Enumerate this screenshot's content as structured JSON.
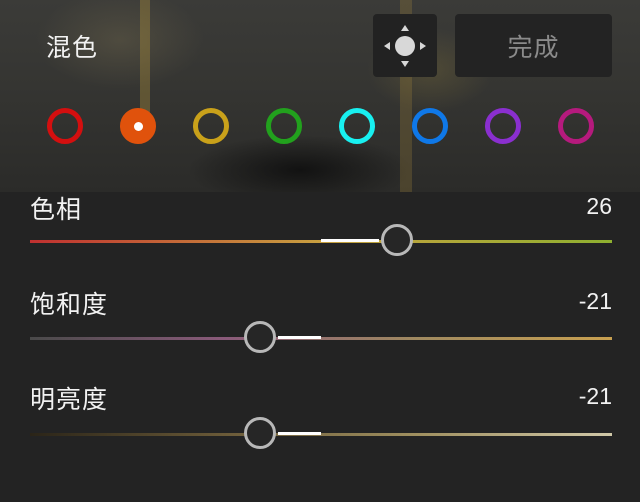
{
  "header": {
    "title": "混色",
    "target_icon": "target-adjust-icon",
    "done_label": "完成"
  },
  "swatches": [
    {
      "name": "red",
      "color": "#d40f0f",
      "selected": false
    },
    {
      "name": "orange",
      "color": "#e0520c",
      "selected": true
    },
    {
      "name": "yellow",
      "color": "#c9a11a",
      "selected": false
    },
    {
      "name": "green",
      "color": "#22a11d",
      "selected": false
    },
    {
      "name": "aqua",
      "color": "#18f0f0",
      "selected": false
    },
    {
      "name": "blue",
      "color": "#0f78e8",
      "selected": false
    },
    {
      "name": "purple",
      "color": "#8a2fcf",
      "selected": false
    },
    {
      "name": "magenta",
      "color": "#b51a7d",
      "selected": false
    }
  ],
  "sliders": [
    {
      "label": "色相",
      "value": "26",
      "numeric": 26,
      "min": -100,
      "max": 100,
      "track_gradient": [
        "#c03030",
        "#c8a040",
        "#8fb030"
      ]
    },
    {
      "label": "饱和度",
      "value": "-21",
      "numeric": -21,
      "min": -100,
      "max": 100,
      "track_gradient": [
        "#4a4a4a",
        "#8a5a7a",
        "#a08a60",
        "#c8a050"
      ]
    },
    {
      "label": "明亮度",
      "value": "-21",
      "numeric": -21,
      "min": -100,
      "max": 100,
      "track_gradient": [
        "#2a2418",
        "#6a5a38",
        "#a09060",
        "#d0c8a8"
      ]
    }
  ]
}
